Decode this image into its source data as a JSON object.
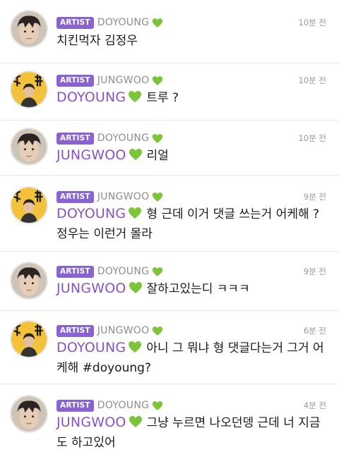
{
  "comments": [
    {
      "badge": "ARTIST",
      "username": "DOYOUNG",
      "time": "10분 전",
      "mention": "",
      "text": "치킨먹자 김정우",
      "avatar": "doyoung"
    },
    {
      "badge": "ARTIST",
      "username": "JUNGWOO",
      "time": "10분 전",
      "mention": "DOYOUNG",
      "text": "트루 ?",
      "avatar": "jungwoo"
    },
    {
      "badge": "ARTIST",
      "username": "DOYOUNG",
      "time": "10분 전",
      "mention": "JUNGWOO",
      "text": "리얼",
      "avatar": "doyoung"
    },
    {
      "badge": "ARTIST",
      "username": "JUNGWOO",
      "time": "9분 전",
      "mention": "DOYOUNG",
      "text": "형 근데 이거 댓글 쓰는거 어케해 ? 정우는 이런거 몰라",
      "avatar": "jungwoo"
    },
    {
      "badge": "ARTIST",
      "username": "DOYOUNG",
      "time": "9분 전",
      "mention": "JUNGWOO",
      "text": "잘하고있는디 ㅋㅋㅋ",
      "avatar": "doyoung"
    },
    {
      "badge": "ARTIST",
      "username": "JUNGWOO",
      "time": "6분 전",
      "mention": "DOYOUNG",
      "text": "아니 그 뭐냐 형 댓글다는거 그거 어케해 #doyoung?",
      "avatar": "jungwoo"
    },
    {
      "badge": "ARTIST",
      "username": "DOYOUNG",
      "time": "4분 전",
      "mention": "JUNGWOO",
      "text": "그냥 누르면 나오던뎅  근데 너 지금도 하고있어",
      "avatar": "doyoung"
    }
  ],
  "colors": {
    "badge": "#8a63d2",
    "mention": "#8a52c9",
    "heart": "#7cc43a"
  },
  "icons": {
    "verified": "green-heart-icon"
  }
}
